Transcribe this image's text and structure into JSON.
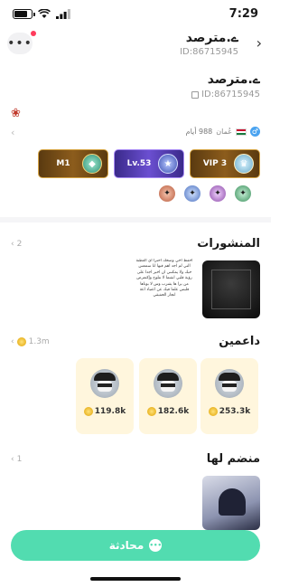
{
  "status_bar": {
    "time": "7:29",
    "battery_level": 0.85
  },
  "header": {
    "name": "ے.مترصد",
    "id": "ID:86715945",
    "menu_icon": "more-icon",
    "back_icon": "chevron-right-icon"
  },
  "profile": {
    "name": "ے.مترصد",
    "id": "ID:86715945",
    "country": "عُمان",
    "days": "988 أيام"
  },
  "badges": [
    {
      "label": "M1"
    },
    {
      "label": "Lv.53"
    },
    {
      "label": "VIP 3"
    }
  ],
  "posts": {
    "title": "المنشورات",
    "count": "2",
    "text_preview": "احفظ اخي وصحك احترا اي الغطنة التي لم اجد اهم فيها انا سمعس حبك ولا يمكنني ان اخبر اجدا على رؤية قلبي انقتما لا تتلوح وإكتعرض من يرا ها يقترب وس لا بوتاها فليس علما فيك عن اعتياد اعة انجار الحفيقي"
  },
  "supporters": {
    "title": "داعمين",
    "total": "1.3m",
    "items": [
      {
        "value": "253.3k"
      },
      {
        "value": "182.6k"
      },
      {
        "value": "119.8k"
      }
    ]
  },
  "joined": {
    "title": "منضم لها",
    "count": "1"
  },
  "chat_button": {
    "label": "محادثة"
  },
  "colors": {
    "accent": "#52dcb0",
    "supporter_card": "#fff6dd",
    "notification": "#ff3b5c"
  }
}
